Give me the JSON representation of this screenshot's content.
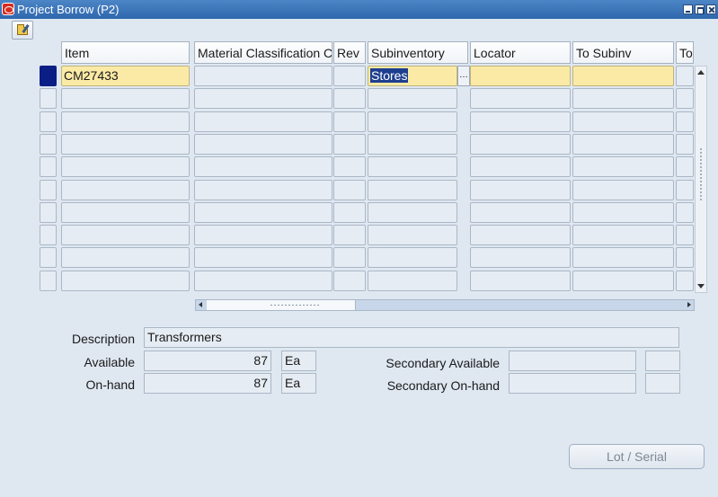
{
  "window": {
    "title": "Project Borrow (P2)"
  },
  "columns": {
    "item": "Item",
    "material_class": "Material Classification C",
    "rev": "Rev",
    "subinventory": "Subinventory",
    "locator": "Locator",
    "to_subinv": "To Subinv",
    "to_more": "To"
  },
  "rows": [
    {
      "item": "CM27433",
      "subinventory": "Stores"
    }
  ],
  "detail": {
    "description_label": "Description",
    "description_value": "Transformers",
    "available_label": "Available",
    "available_value": "87",
    "available_uom": "Ea",
    "onhand_label": "On-hand",
    "onhand_value": "87",
    "onhand_uom": "Ea",
    "sec_available_label": "Secondary Available",
    "sec_onhand_label": "Secondary On-hand"
  },
  "buttons": {
    "lot_serial": "Lot / Serial"
  },
  "colors": {
    "title_bar": "#2e67ad",
    "required_field": "#fbeaa5",
    "current_record": "#0b1e86",
    "background": "#dfe7f1"
  },
  "icons": {
    "toolbar": "open-folder-icon",
    "app": "oracle-icon"
  }
}
